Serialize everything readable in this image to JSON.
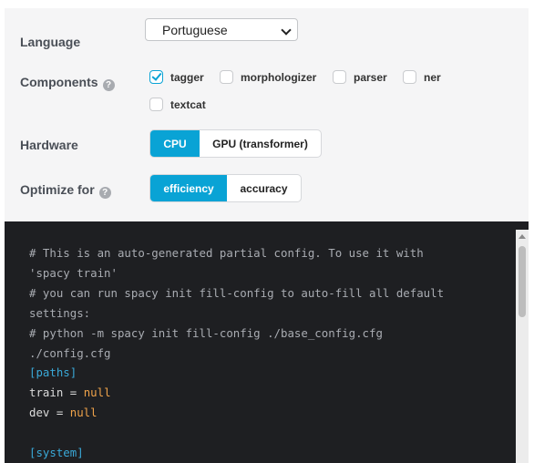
{
  "language": {
    "label": "Language",
    "selected": "Portuguese"
  },
  "components": {
    "label": "Components",
    "options": [
      {
        "label": "tagger",
        "checked": true
      },
      {
        "label": "morphologizer",
        "checked": false
      },
      {
        "label": "parser",
        "checked": false
      },
      {
        "label": "ner",
        "checked": false
      },
      {
        "label": "textcat",
        "checked": false
      }
    ]
  },
  "hardware": {
    "label": "Hardware",
    "options": [
      "CPU",
      "GPU (transformer)"
    ],
    "selected": "CPU"
  },
  "optimize": {
    "label": "Optimize for",
    "options": [
      "efficiency",
      "accuracy"
    ],
    "selected": "efficiency"
  },
  "code": {
    "lines": [
      "# This is an auto-generated partial config. To use it with",
      "'spacy train'",
      "# you can run spacy init fill-config to auto-fill all default",
      "settings:",
      "# python -m spacy init fill-config ./base_config.cfg",
      "./config.cfg",
      "[paths]",
      "train = ",
      "null",
      "dev = ",
      "null",
      "[system]"
    ]
  },
  "colors": {
    "accent": "#09a3d5",
    "code_bg": "#1e1f22"
  }
}
